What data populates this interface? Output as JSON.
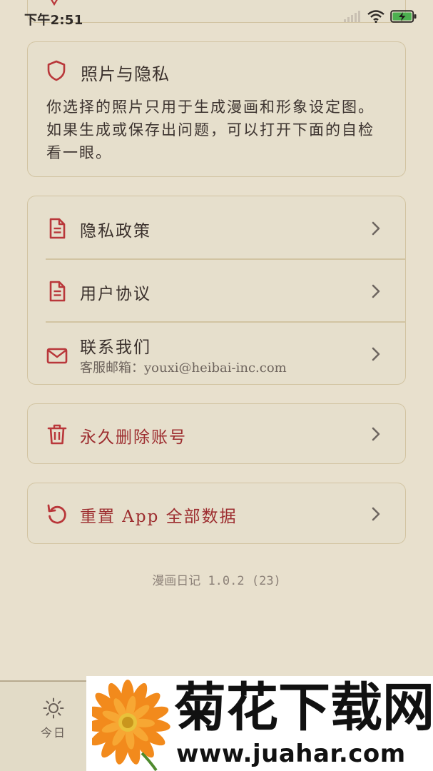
{
  "status_bar": {
    "time": "下午2:51",
    "icons": [
      "signal-icon",
      "wifi-icon",
      "battery-charging-icon"
    ]
  },
  "privacy_card": {
    "title": "照片与隐私",
    "body": "你选择的照片只用于生成漫画和形象设定图。如果生成或保存出问题，可以打开下面的自检看一眼。",
    "icon": "shield-icon"
  },
  "links": [
    {
      "label": "隐私政策",
      "icon": "document-icon"
    },
    {
      "label": "用户协议",
      "icon": "document-icon"
    },
    {
      "label": "联系我们",
      "icon": "mail-icon",
      "subtext": "客服邮箱：youxi@heibai-inc.com"
    }
  ],
  "danger": {
    "delete_label": "永久删除账号",
    "delete_icon": "trash-icon",
    "reset_label": "重置 App 全部数据",
    "reset_icon": "reset-icon"
  },
  "version": "漫画日记 1.0.2 (23)",
  "bottom_nav": {
    "today_label": "今日",
    "today_icon": "sun-icon"
  },
  "watermark": {
    "title": "菊花下载网",
    "url": "www.juahar.com"
  },
  "colors": {
    "background": "#e8e0cd",
    "card": "#e6dfcc",
    "card_border": "#d2c4a2",
    "accent_red": "#b9373a",
    "danger_text": "#9d2d2f",
    "text": "#3a302c"
  }
}
